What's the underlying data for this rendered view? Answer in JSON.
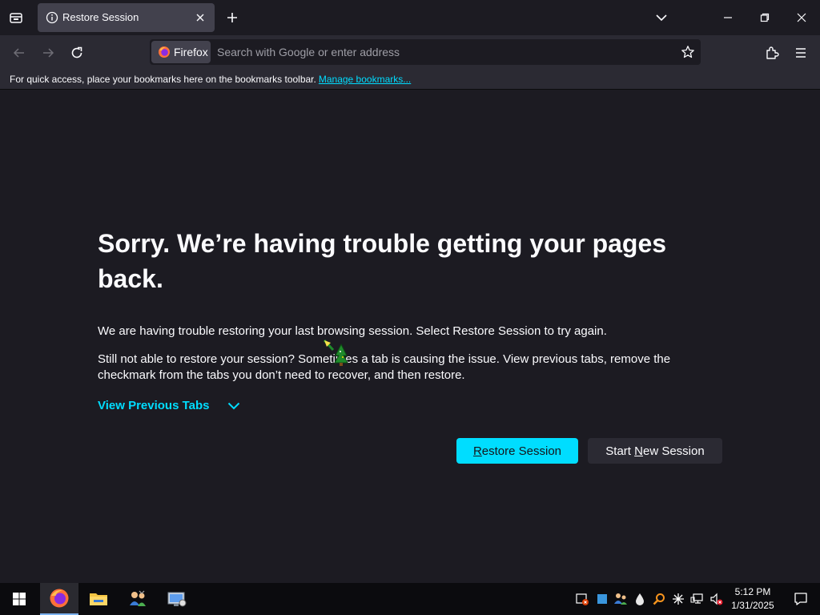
{
  "browser": {
    "tab": {
      "title": "Restore Session"
    },
    "urlbar": {
      "identity_label": "Firefox",
      "placeholder": "Search with Google or enter address"
    },
    "bookmarks_bar": {
      "text": "For quick access, place your bookmarks here on the bookmarks toolbar.",
      "link": "Manage bookmarks..."
    }
  },
  "page": {
    "title": "Sorry. We’re having trouble getting your pages back.",
    "p1": "We are having trouble restoring your last browsing session. Select Restore Session to try again.",
    "p2": "Still not able to restore your session? Sometimes a tab is causing the issue. View previous tabs, remove the checkmark from the tabs you don’t need to recover, and then restore.",
    "view_previous_tabs": "View Previous Tabs",
    "restore_button": {
      "accesskey": "R",
      "rest": "estore Session"
    },
    "new_session_button": {
      "before": "Start ",
      "accesskey": "N",
      "after": "ew Session"
    }
  },
  "taskbar": {
    "time": "5:12 PM",
    "date": "1/31/2025"
  },
  "colors": {
    "accent": "#00ddff",
    "page_bg": "#1c1b22",
    "toolbar_bg": "#2b2a33",
    "tab_selected_bg": "#42414d"
  },
  "icons": {
    "tab": "info-icon",
    "tabstrip_left": "firefox-view-icon",
    "newtab": "plus-icon",
    "alltabs": "chevron-down-icon",
    "window": [
      "minimize-icon",
      "restore-icon",
      "close-icon"
    ],
    "nav": [
      "back-icon",
      "forward-icon",
      "reload-icon"
    ],
    "toolbar_right": [
      "extensions-icon",
      "hamburger-menu-icon"
    ],
    "taskbar_apps": [
      "firefox-icon",
      "file-explorer-icon",
      "network-users-icon",
      "system-manager-icon"
    ]
  }
}
